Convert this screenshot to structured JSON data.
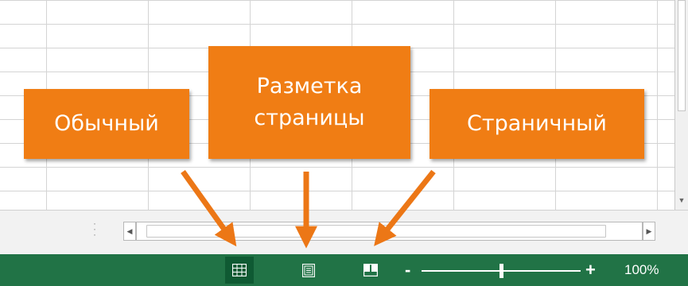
{
  "callouts": {
    "normal_label": "Обычный",
    "page_layout_label": "Разметка\nстраницы",
    "page_break_label": "Страничный"
  },
  "statusbar": {
    "view_buttons": [
      {
        "icon": "grid-icon",
        "active": true
      },
      {
        "icon": "page-layout-icon",
        "active": false
      },
      {
        "icon": "page-break-icon",
        "active": false
      }
    ],
    "zoom_minus": "-",
    "zoom_plus": "+",
    "zoom_level": "100%",
    "zoom_fraction": 0.5
  },
  "colors": {
    "statusbar_bg": "#217346",
    "active_view_bg": "#0f5a33",
    "callout_bg": "#f07d14",
    "arrow": "#ec7716"
  }
}
